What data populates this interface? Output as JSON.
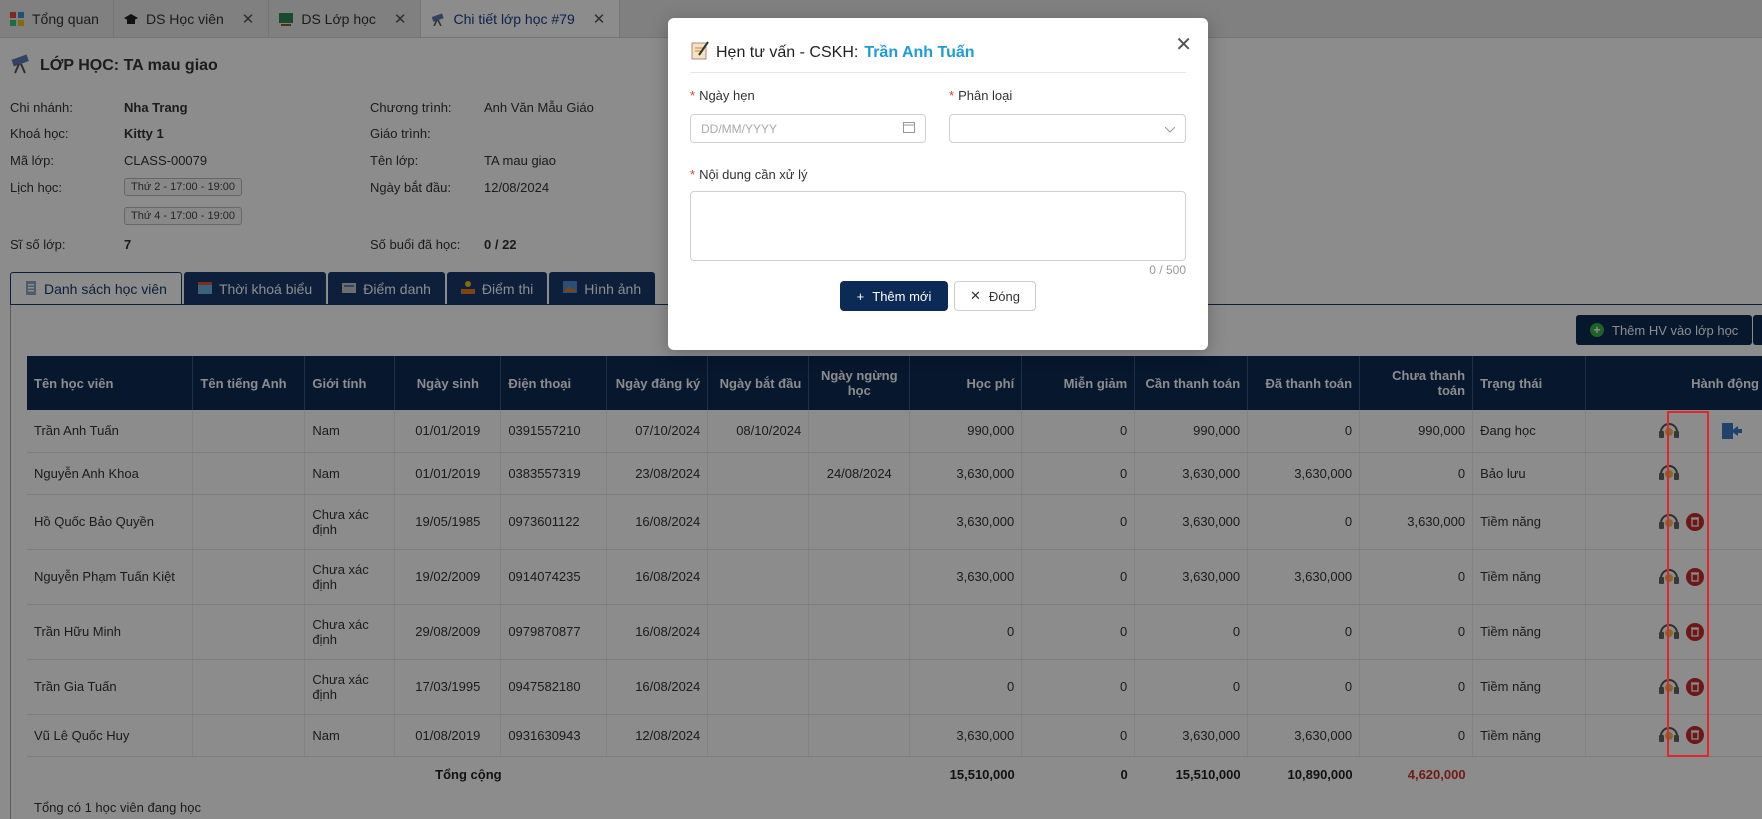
{
  "topTabs": [
    {
      "label": "Tổng quan",
      "closable": false
    },
    {
      "label": "DS Học viên",
      "closable": true
    },
    {
      "label": "DS Lớp học",
      "closable": true
    },
    {
      "label": "Chi tiết lớp học #79",
      "closable": true
    }
  ],
  "page": {
    "title": "LỚP HỌC: TA mau giao"
  },
  "info": {
    "branch_label": "Chi nhánh:",
    "branch": "Nha Trang",
    "course_label": "Khoá học:",
    "course": "Kitty 1",
    "code_label": "Mã lớp:",
    "code": "CLASS-00079",
    "schedule_label": "Lịch học:",
    "schedule": [
      "Thứ 2 - 17:00 - 19:00",
      "Thứ 4 - 17:00 - 19:00"
    ],
    "size_label": "Sĩ số lớp:",
    "size": "7",
    "program_label": "Chương trình:",
    "program": "Anh Văn Mẫu Giáo",
    "curriculum_label": "Giáo trình:",
    "curriculum": "",
    "name_label": "Tên lớp:",
    "name": "TA mau giao",
    "start_label": "Ngày bắt đầu:",
    "start": "12/08/2024",
    "sessions_label": "Số buổi đã học:",
    "sessions": "0 / 22"
  },
  "contentTabs": [
    "Danh sách học viên",
    "Thời khoá biểu",
    "Điểm danh",
    "Điểm thi",
    "Hình ảnh"
  ],
  "addStudentButton": "Thêm HV vào lớp học",
  "table": {
    "headers": [
      "Tên học viên",
      "Tên tiếng Anh",
      "Giới tính",
      "Ngày sinh",
      "Điện thoại",
      "Ngày đăng ký",
      "Ngày bắt đầu",
      "Ngày ngừng học",
      "Học phí",
      "Miễn giảm",
      "Cần thanh toán",
      "Đã thanh toán",
      "Chưa thanh toán",
      "Trạng thái",
      "Hành động"
    ],
    "rows": [
      [
        "Trần Anh Tuấn",
        "",
        "Nam",
        "01/01/2019",
        "0391557210",
        "07/10/2024",
        "08/10/2024",
        "",
        "990,000",
        "0",
        "990,000",
        "0",
        "990,000",
        "Đang học"
      ],
      [
        "Nguyễn Anh Khoa",
        "",
        "Nam",
        "01/01/2019",
        "0383557319",
        "23/08/2024",
        "",
        "24/08/2024",
        "3,630,000",
        "0",
        "3,630,000",
        "3,630,000",
        "0",
        "Bảo lưu"
      ],
      [
        "Hồ Quốc Bảo Quyền",
        "",
        "Chưa xác định",
        "19/05/1985",
        "0973601122",
        "16/08/2024",
        "",
        "",
        "3,630,000",
        "0",
        "3,630,000",
        "0",
        "3,630,000",
        "Tiềm năng"
      ],
      [
        "Nguyễn Phạm Tuấn Kiệt",
        "",
        "Chưa xác định",
        "19/02/2009",
        "0914074235",
        "16/08/2024",
        "",
        "",
        "3,630,000",
        "0",
        "3,630,000",
        "3,630,000",
        "0",
        "Tiềm năng"
      ],
      [
        "Trần Hữu Minh",
        "",
        "Chưa xác định",
        "29/08/2009",
        "0979870877",
        "16/08/2024",
        "",
        "",
        "0",
        "0",
        "0",
        "0",
        "0",
        "Tiềm năng"
      ],
      [
        "Trần Gia Tuấn",
        "",
        "Chưa xác định",
        "17/03/1995",
        "0947582180",
        "16/08/2024",
        "",
        "",
        "0",
        "0",
        "0",
        "0",
        "0",
        "Tiềm năng"
      ],
      [
        "Vũ Lê Quốc Huy",
        "",
        "Nam",
        "01/08/2019",
        "0931630943",
        "12/08/2024",
        "",
        "",
        "3,630,000",
        "0",
        "3,630,000",
        "3,630,000",
        "0",
        "Tiềm năng"
      ]
    ],
    "total": {
      "label": "Tổng cộng",
      "fee": "15,510,000",
      "discount": "0",
      "due": "15,510,000",
      "paid": "10,890,000",
      "unpaid": "4,620,000"
    }
  },
  "footerNote": "Tổng có 1 học viên đang học",
  "modal": {
    "title_prefix": "Hẹn tư vấn - CSKH:",
    "title_name": "Trần Anh Tuấn",
    "date_label": "Ngày hẹn",
    "date_placeholder": "DD/MM/YYYY",
    "category_label": "Phân loại",
    "content_label": "Nội dung cần xử lý",
    "char_count": "0 / 500",
    "add_button": "Thêm mới",
    "close_button": "Đóng"
  },
  "colors": {
    "primary": "#0b2a55",
    "accent": "#1d9bd6",
    "danger": "#c82b2b",
    "highlight": "#e0262a"
  }
}
